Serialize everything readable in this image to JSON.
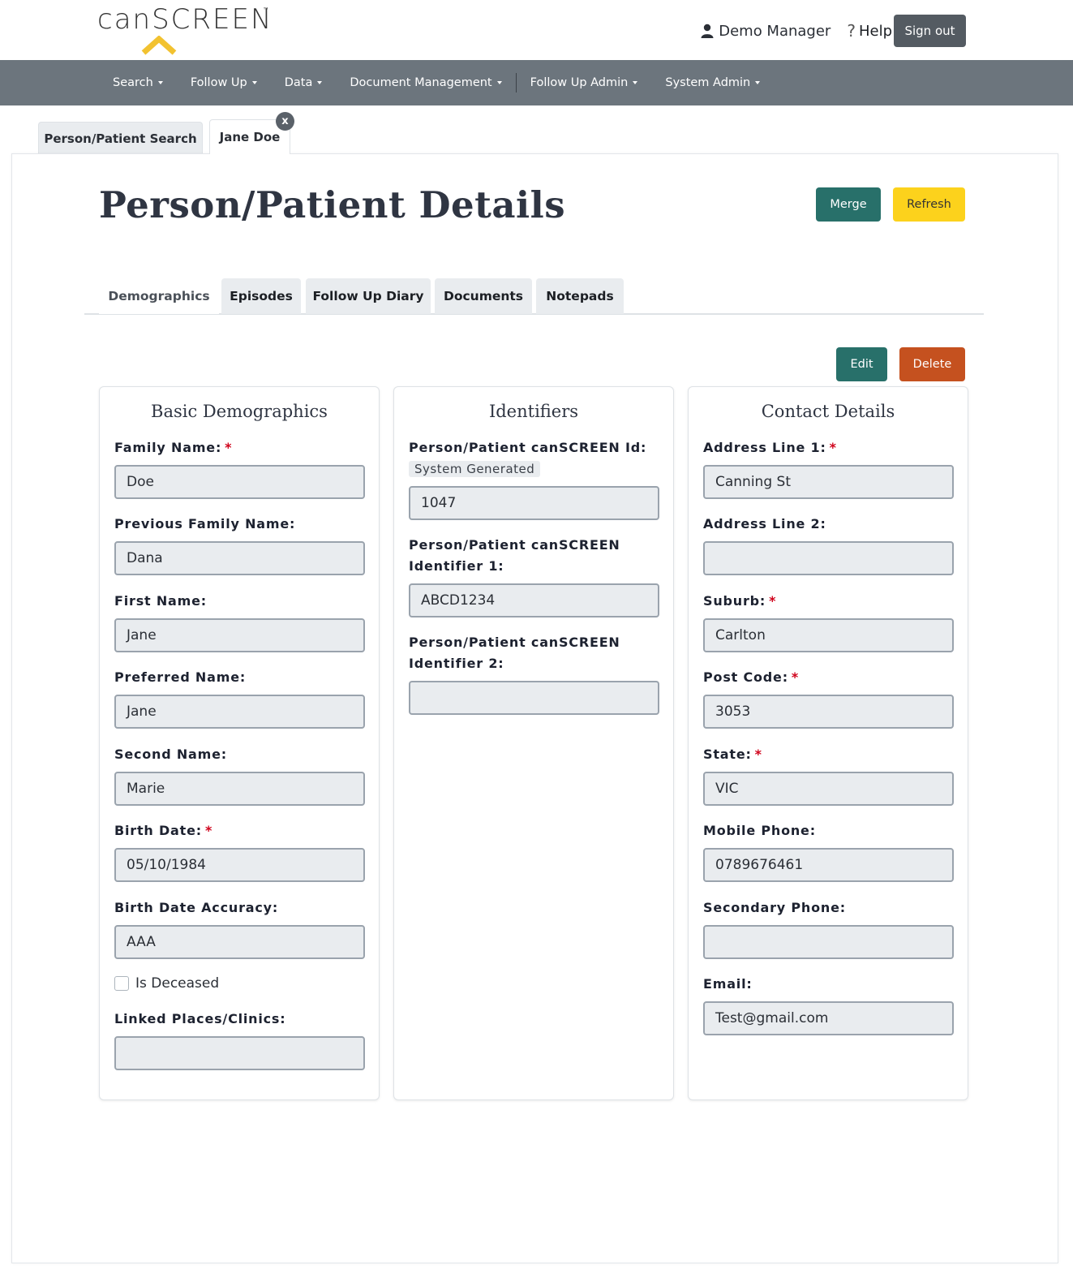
{
  "header": {
    "logo_text": "canSCREEN",
    "logo_tm": "™",
    "user_name": "Demo Manager",
    "help_label": "Help",
    "signout_label": "Sign out"
  },
  "nav": {
    "items": [
      {
        "label": "Search"
      },
      {
        "label": "Follow Up"
      },
      {
        "label": "Data"
      },
      {
        "label": "Document Management"
      },
      {
        "label": "Follow Up Admin"
      },
      {
        "label": "System Admin"
      }
    ]
  },
  "outer_tabs": {
    "search_label": "Person/Patient Search",
    "patient_label": "Jane Doe",
    "close_label": "x"
  },
  "page": {
    "title": "Person/Patient Details",
    "merge_label": "Merge",
    "refresh_label": "Refresh",
    "edit_label": "Edit",
    "delete_label": "Delete"
  },
  "inner_tabs": [
    {
      "label": "Demographics",
      "active": true
    },
    {
      "label": "Episodes"
    },
    {
      "label": "Follow Up Diary"
    },
    {
      "label": "Documents"
    },
    {
      "label": "Notepads"
    }
  ],
  "basic": {
    "title": "Basic Demographics",
    "family_name_label": "Family Name:",
    "family_name": "Doe",
    "previous_family_name_label": "Previous Family Name:",
    "previous_family_name": "Dana",
    "first_name_label": "First Name:",
    "first_name": "Jane",
    "preferred_name_label": "Preferred Name:",
    "preferred_name": "Jane",
    "second_name_label": "Second Name:",
    "second_name": "Marie",
    "birth_date_label": "Birth Date:",
    "birth_date": "05/10/1984",
    "birth_date_accuracy_label": "Birth Date Accuracy:",
    "birth_date_accuracy": "AAA",
    "is_deceased_label": "Is Deceased",
    "linked_places_label": "Linked Places/Clinics:",
    "linked_places": ""
  },
  "identifiers": {
    "title": "Identifiers",
    "id_label": "Person/Patient canSCREEN Id:",
    "system_generated": "System Generated",
    "id_value": "1047",
    "identifier1_label": "Person/Patient canSCREEN Identifier 1:",
    "identifier1": "ABCD1234",
    "identifier2_label": "Person/Patient canSCREEN Identifier 2:",
    "identifier2": ""
  },
  "contact": {
    "title": "Contact Details",
    "address1_label": "Address Line 1:",
    "address1": "Canning St",
    "address2_label": "Address Line 2:",
    "address2": "",
    "suburb_label": "Suburb:",
    "suburb": "Carlton",
    "postcode_label": "Post Code:",
    "postcode": "3053",
    "state_label": "State:",
    "state": "VIC",
    "mobile_label": "Mobile Phone:",
    "mobile": "0789676461",
    "secondary_label": "Secondary Phone:",
    "secondary": "",
    "email_label": "Email:",
    "email": "Test@gmail.com"
  },
  "required_mark": "*",
  "colors": {
    "navbar": "#6c757d",
    "primary_green": "#28706a",
    "refresh_yellow": "#fcd21c",
    "delete_orange": "#c5511f",
    "logo_chevron": "#f2c230"
  }
}
